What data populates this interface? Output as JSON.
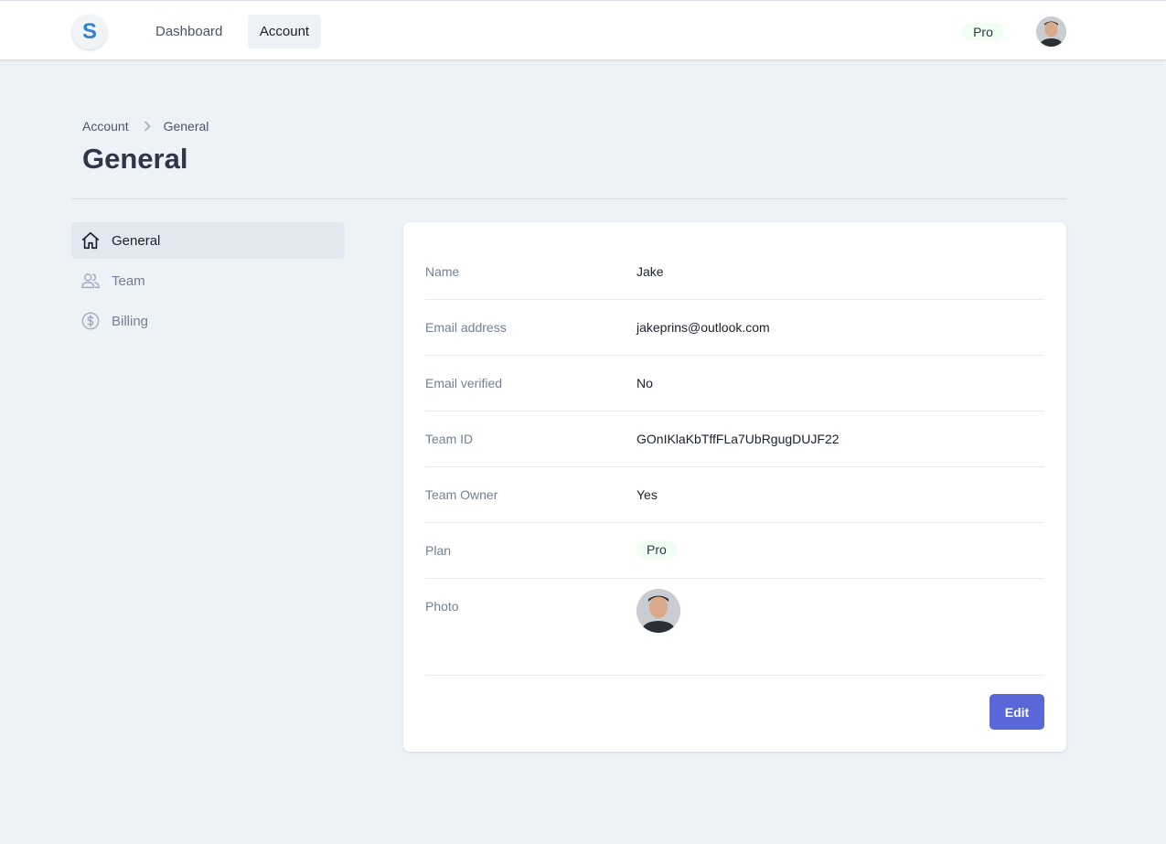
{
  "header": {
    "logo_letter": "S",
    "nav": [
      {
        "label": "Dashboard",
        "active": false
      },
      {
        "label": "Account",
        "active": true
      }
    ],
    "plan_badge": "Pro"
  },
  "breadcrumb": [
    "Account",
    "General"
  ],
  "page_title": "General",
  "sidebar": {
    "items": [
      {
        "label": "General",
        "icon": "home-icon",
        "active": true
      },
      {
        "label": "Team",
        "icon": "users-icon",
        "active": false
      },
      {
        "label": "Billing",
        "icon": "dollar-circle-icon",
        "active": false
      }
    ]
  },
  "details": {
    "name": {
      "label": "Name",
      "value": "Jake"
    },
    "email": {
      "label": "Email address",
      "value": "jakeprins@outlook.com"
    },
    "email_verified": {
      "label": "Email verified",
      "value": "No"
    },
    "team_id": {
      "label": "Team ID",
      "value": "GOnIKlaKbTffFLa7UbRgugDUJF22"
    },
    "team_owner": {
      "label": "Team Owner",
      "value": "Yes"
    },
    "plan": {
      "label": "Plan",
      "value": "Pro"
    },
    "photo": {
      "label": "Photo"
    }
  },
  "actions": {
    "edit_label": "Edit"
  },
  "colors": {
    "accent": "#5a67d8",
    "background": "#edf2f7",
    "badge": "#f0fff4"
  }
}
